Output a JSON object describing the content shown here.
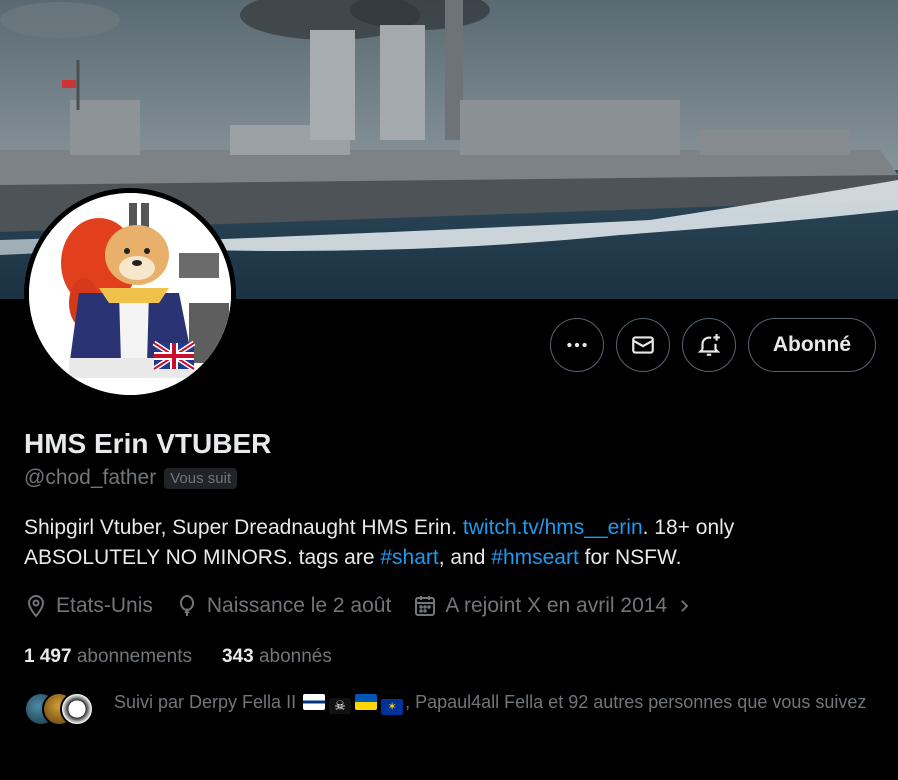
{
  "profile": {
    "display_name": "HMS Erin VTUBER",
    "handle": "@chod_father",
    "follows_you_badge": "Vous suit",
    "bio_part1": "Shipgirl Vtuber, Super Dreadnaught HMS Erin. ",
    "bio_link": "twitch.tv/hms__erin",
    "bio_part2": ". 18+ only ABSOLUTELY NO MINORS. tags are ",
    "bio_tag1": "#shart",
    "bio_part3": ", and ",
    "bio_tag2": "#hmseart",
    "bio_part4": " for NSFW."
  },
  "actions": {
    "more_icon": "more-icon",
    "message_icon": "envelope-icon",
    "notify_icon": "bell-plus-icon",
    "follow_label": "Abonné"
  },
  "meta": {
    "location": "Etats-Unis",
    "birthday": "Naissance le 2 août",
    "joined": "A rejoint X en avril 2014"
  },
  "stats": {
    "following_count": "1 497",
    "following_label": "abonnements",
    "followers_count": "343",
    "followers_label": "abonnés"
  },
  "followed_by": {
    "prefix": "Suivi par Derpy Fella II",
    "suffix": ", Papaul4all Fella et 92 autres personnes que vous suivez"
  },
  "colors": {
    "background": "#000000",
    "text_primary": "#e7e9ea",
    "text_secondary": "#71767b",
    "link": "#1d9bf0",
    "border": "#536471"
  }
}
